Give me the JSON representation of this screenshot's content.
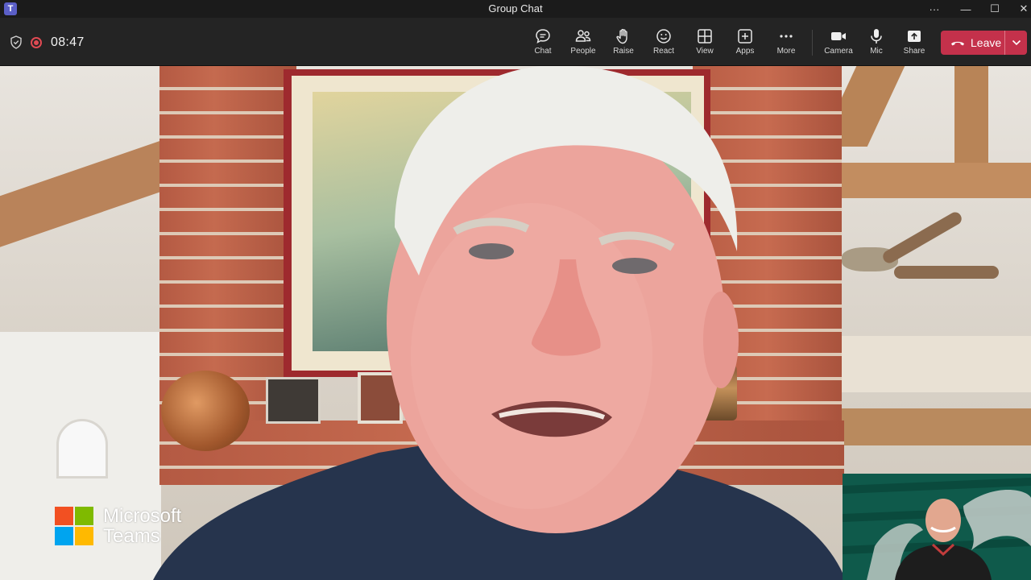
{
  "window": {
    "title": "Group Chat",
    "controls": {
      "more": "···",
      "minimize": "—",
      "maximize": "☐",
      "close": "✕"
    }
  },
  "call": {
    "timer": "08:47",
    "recording": true,
    "icons": {
      "security": "shield-icon",
      "recording": "record-icon"
    }
  },
  "toolbar": {
    "buttons": [
      {
        "id": "chat",
        "label": "Chat",
        "icon": "chat-icon"
      },
      {
        "id": "people",
        "label": "People",
        "icon": "people-icon"
      },
      {
        "id": "raise",
        "label": "Raise",
        "icon": "hand-icon"
      },
      {
        "id": "react",
        "label": "React",
        "icon": "smiley-icon"
      },
      {
        "id": "view",
        "label": "View",
        "icon": "grid-icon"
      },
      {
        "id": "apps",
        "label": "Apps",
        "icon": "plus-box-icon"
      },
      {
        "id": "more",
        "label": "More",
        "icon": "ellipsis-icon"
      },
      {
        "id": "camera",
        "label": "Camera",
        "icon": "camera-icon"
      },
      {
        "id": "mic",
        "label": "Mic",
        "icon": "microphone-icon"
      },
      {
        "id": "share",
        "label": "Share",
        "icon": "share-icon"
      }
    ],
    "leave_label": "Leave",
    "leave_color": "#c4314b"
  },
  "branding": {
    "line1": "Microsoft",
    "line2": "Teams",
    "logo_colors": [
      "#f25022",
      "#7fba00",
      "#00a4ef",
      "#ffb900"
    ]
  },
  "colors": {
    "titlebar": "#1b1b1b",
    "toolbar": "#242424",
    "record": "#e04a53"
  }
}
